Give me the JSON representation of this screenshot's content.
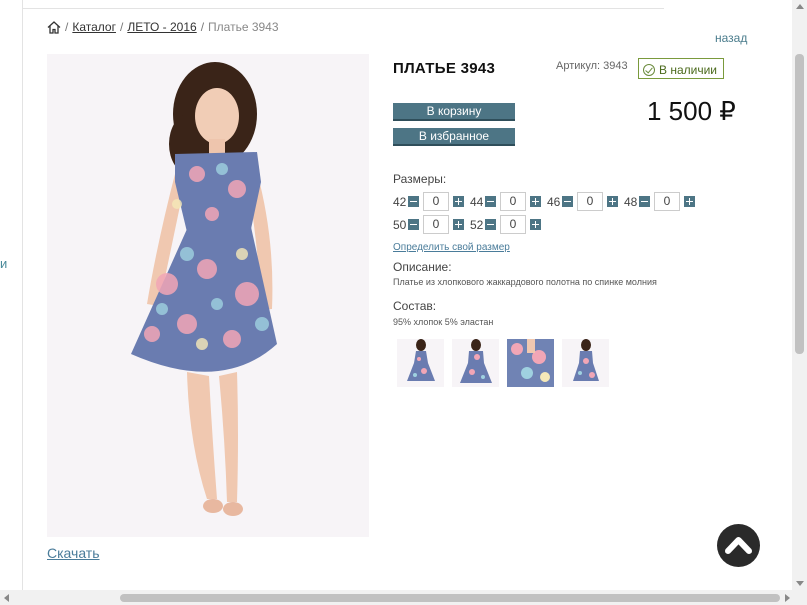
{
  "sidebar": {
    "edge_letter": "и"
  },
  "breadcrumb": {
    "home_icon": "home-icon",
    "separator": "/",
    "items": [
      "Каталог",
      "ЛЕТО - 2016"
    ],
    "current": "Платье 3943"
  },
  "back_link": "назад",
  "product": {
    "title": "ПЛАТЬЕ 3943",
    "sku": "Артикул: 3943",
    "stock": "В наличии",
    "price": "1 500 ₽",
    "add_to_cart": "В корзину",
    "add_to_favorites": "В избранное",
    "sizes_label": "Размеры:",
    "sizes": [
      {
        "size": "42",
        "qty": "0"
      },
      {
        "size": "44",
        "qty": "0"
      },
      {
        "size": "46",
        "qty": "0"
      },
      {
        "size": "48",
        "qty": "0"
      },
      {
        "size": "50",
        "qty": "0"
      },
      {
        "size": "52",
        "qty": "0"
      }
    ],
    "size_link": "Определить свой размер",
    "description_label": "Описание:",
    "description": "Платье из хлопкового жаккардового полотна по спинке молния",
    "composition_label": "Состав:",
    "composition": "95% хлопок 5% эластан",
    "thumbnail_count": 4
  },
  "download_link": "Скачать",
  "colors": {
    "button": "#4d7585",
    "stock_border": "#7a9a3c",
    "link": "#4a7c9a"
  }
}
